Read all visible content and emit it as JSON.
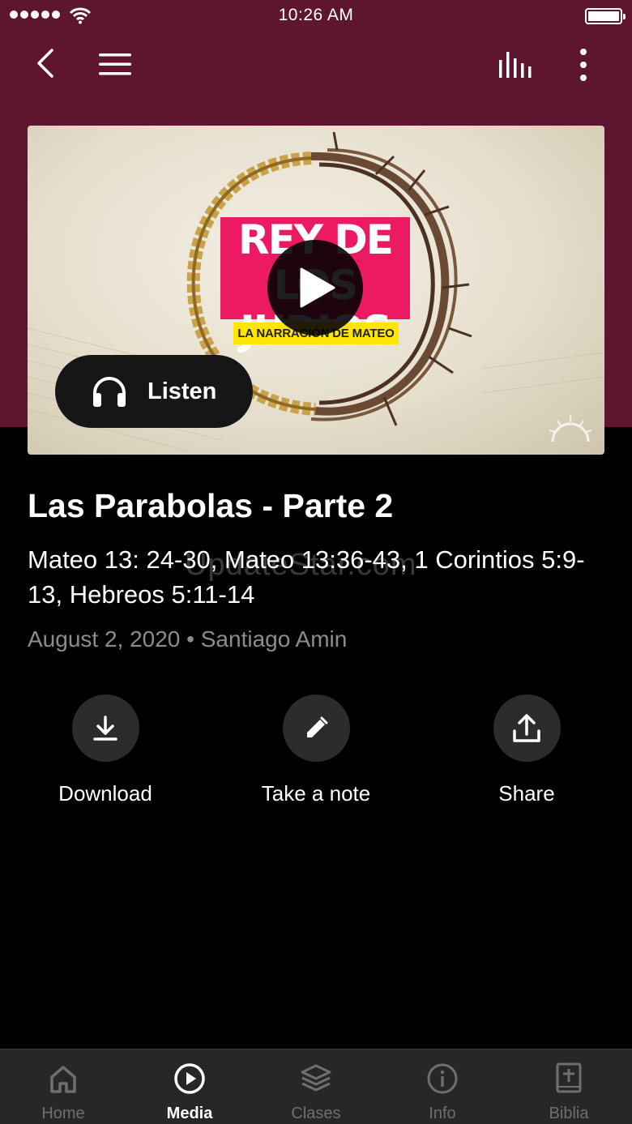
{
  "status_bar": {
    "time": "10:26 AM",
    "battery_level": 1.0,
    "signal_dots": 5
  },
  "nav": {
    "back_icon": "chevron-left-icon",
    "menu_icon": "hamburger-icon",
    "audio_icon": "audio-bars-icon",
    "more_icon": "more-vertical-icon"
  },
  "media": {
    "artwork_title_line1": "REY DE",
    "artwork_title_line2": "LOS JUDIOS",
    "artwork_subtitle": "LA NARRACIÓN DE MATEO",
    "play_icon": "play-icon",
    "listen_label": "Listen"
  },
  "sermon": {
    "title": "Las Parabolas - Parte 2",
    "references": "Mateo 13: 24-30, Mateo 13:36-43, 1 Corintios 5:9-13, Hebreos 5:11-14",
    "date": "August 2, 2020",
    "separator": "•",
    "speaker": "Santiago Amin"
  },
  "overlay_watermark": "UpdateStar.com",
  "actions": [
    {
      "label": "Download",
      "icon": "download-icon"
    },
    {
      "label": "Take a note",
      "icon": "pencil-icon"
    },
    {
      "label": "Share",
      "icon": "share-icon"
    }
  ],
  "tabs": [
    {
      "label": "Home",
      "icon": "home-icon",
      "active": false
    },
    {
      "label": "Media",
      "icon": "play-circle-icon",
      "active": true
    },
    {
      "label": "Clases",
      "icon": "layers-icon",
      "active": false
    },
    {
      "label": "Info",
      "icon": "info-icon",
      "active": false
    },
    {
      "label": "Biblia",
      "icon": "bible-icon",
      "active": false
    }
  ],
  "colors": {
    "header": "#5e1530",
    "background": "#000000",
    "tab_bar": "#272727",
    "artwork_pink": "#ec1a63",
    "artwork_yellow": "#ffe600"
  }
}
